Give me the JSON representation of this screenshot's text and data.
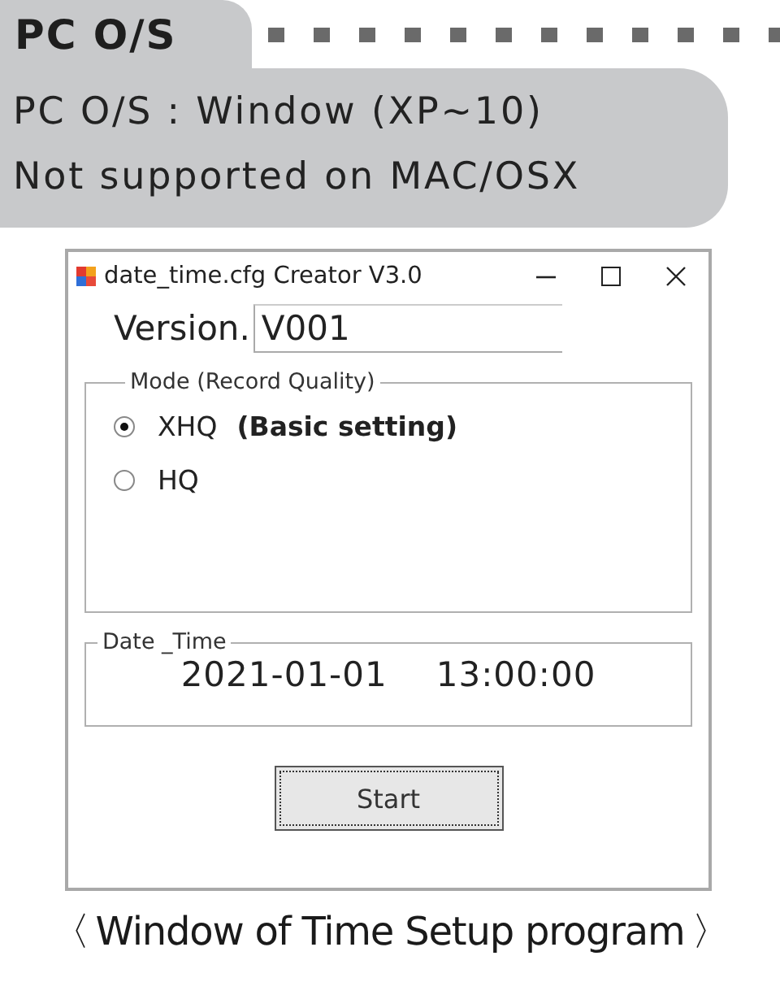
{
  "header": {
    "tab": "PC O/S",
    "lines": [
      "PC O/S : Window (XP~10)",
      "Not supported on MAC/OSX"
    ]
  },
  "window": {
    "title": "date_time.cfg Creator V3.0",
    "version_label": "Version.",
    "version_value": "V001",
    "mode_group": {
      "legend": "Mode (Record Quality)",
      "options": [
        {
          "label": "XHQ",
          "note": "(Basic setting)",
          "selected": true
        },
        {
          "label": "HQ",
          "selected": false
        }
      ]
    },
    "date_group": {
      "legend": "Date _Time",
      "date": "2021-01-01",
      "time": "13:00:00"
    },
    "button": "Start"
  },
  "caption": {
    "open": "〈",
    "text": "Window of Time Setup program",
    "close": "〉"
  }
}
